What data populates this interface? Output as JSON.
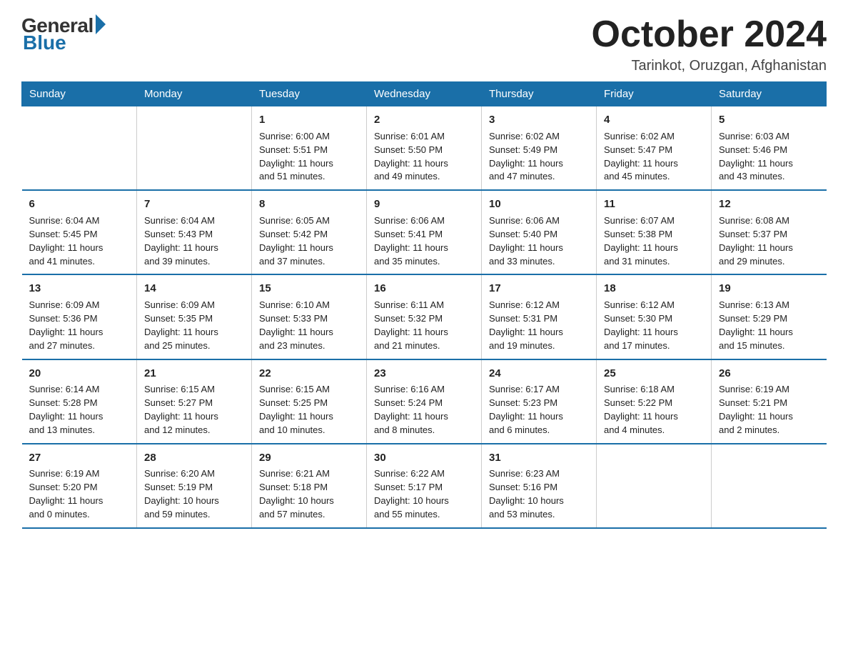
{
  "logo": {
    "general": "General",
    "blue": "Blue"
  },
  "title": "October 2024",
  "location": "Tarinkot, Oruzgan, Afghanistan",
  "headers": [
    "Sunday",
    "Monday",
    "Tuesday",
    "Wednesday",
    "Thursday",
    "Friday",
    "Saturday"
  ],
  "weeks": [
    [
      {
        "day": "",
        "info": ""
      },
      {
        "day": "",
        "info": ""
      },
      {
        "day": "1",
        "info": "Sunrise: 6:00 AM\nSunset: 5:51 PM\nDaylight: 11 hours\nand 51 minutes."
      },
      {
        "day": "2",
        "info": "Sunrise: 6:01 AM\nSunset: 5:50 PM\nDaylight: 11 hours\nand 49 minutes."
      },
      {
        "day": "3",
        "info": "Sunrise: 6:02 AM\nSunset: 5:49 PM\nDaylight: 11 hours\nand 47 minutes."
      },
      {
        "day": "4",
        "info": "Sunrise: 6:02 AM\nSunset: 5:47 PM\nDaylight: 11 hours\nand 45 minutes."
      },
      {
        "day": "5",
        "info": "Sunrise: 6:03 AM\nSunset: 5:46 PM\nDaylight: 11 hours\nand 43 minutes."
      }
    ],
    [
      {
        "day": "6",
        "info": "Sunrise: 6:04 AM\nSunset: 5:45 PM\nDaylight: 11 hours\nand 41 minutes."
      },
      {
        "day": "7",
        "info": "Sunrise: 6:04 AM\nSunset: 5:43 PM\nDaylight: 11 hours\nand 39 minutes."
      },
      {
        "day": "8",
        "info": "Sunrise: 6:05 AM\nSunset: 5:42 PM\nDaylight: 11 hours\nand 37 minutes."
      },
      {
        "day": "9",
        "info": "Sunrise: 6:06 AM\nSunset: 5:41 PM\nDaylight: 11 hours\nand 35 minutes."
      },
      {
        "day": "10",
        "info": "Sunrise: 6:06 AM\nSunset: 5:40 PM\nDaylight: 11 hours\nand 33 minutes."
      },
      {
        "day": "11",
        "info": "Sunrise: 6:07 AM\nSunset: 5:38 PM\nDaylight: 11 hours\nand 31 minutes."
      },
      {
        "day": "12",
        "info": "Sunrise: 6:08 AM\nSunset: 5:37 PM\nDaylight: 11 hours\nand 29 minutes."
      }
    ],
    [
      {
        "day": "13",
        "info": "Sunrise: 6:09 AM\nSunset: 5:36 PM\nDaylight: 11 hours\nand 27 minutes."
      },
      {
        "day": "14",
        "info": "Sunrise: 6:09 AM\nSunset: 5:35 PM\nDaylight: 11 hours\nand 25 minutes."
      },
      {
        "day": "15",
        "info": "Sunrise: 6:10 AM\nSunset: 5:33 PM\nDaylight: 11 hours\nand 23 minutes."
      },
      {
        "day": "16",
        "info": "Sunrise: 6:11 AM\nSunset: 5:32 PM\nDaylight: 11 hours\nand 21 minutes."
      },
      {
        "day": "17",
        "info": "Sunrise: 6:12 AM\nSunset: 5:31 PM\nDaylight: 11 hours\nand 19 minutes."
      },
      {
        "day": "18",
        "info": "Sunrise: 6:12 AM\nSunset: 5:30 PM\nDaylight: 11 hours\nand 17 minutes."
      },
      {
        "day": "19",
        "info": "Sunrise: 6:13 AM\nSunset: 5:29 PM\nDaylight: 11 hours\nand 15 minutes."
      }
    ],
    [
      {
        "day": "20",
        "info": "Sunrise: 6:14 AM\nSunset: 5:28 PM\nDaylight: 11 hours\nand 13 minutes."
      },
      {
        "day": "21",
        "info": "Sunrise: 6:15 AM\nSunset: 5:27 PM\nDaylight: 11 hours\nand 12 minutes."
      },
      {
        "day": "22",
        "info": "Sunrise: 6:15 AM\nSunset: 5:25 PM\nDaylight: 11 hours\nand 10 minutes."
      },
      {
        "day": "23",
        "info": "Sunrise: 6:16 AM\nSunset: 5:24 PM\nDaylight: 11 hours\nand 8 minutes."
      },
      {
        "day": "24",
        "info": "Sunrise: 6:17 AM\nSunset: 5:23 PM\nDaylight: 11 hours\nand 6 minutes."
      },
      {
        "day": "25",
        "info": "Sunrise: 6:18 AM\nSunset: 5:22 PM\nDaylight: 11 hours\nand 4 minutes."
      },
      {
        "day": "26",
        "info": "Sunrise: 6:19 AM\nSunset: 5:21 PM\nDaylight: 11 hours\nand 2 minutes."
      }
    ],
    [
      {
        "day": "27",
        "info": "Sunrise: 6:19 AM\nSunset: 5:20 PM\nDaylight: 11 hours\nand 0 minutes."
      },
      {
        "day": "28",
        "info": "Sunrise: 6:20 AM\nSunset: 5:19 PM\nDaylight: 10 hours\nand 59 minutes."
      },
      {
        "day": "29",
        "info": "Sunrise: 6:21 AM\nSunset: 5:18 PM\nDaylight: 10 hours\nand 57 minutes."
      },
      {
        "day": "30",
        "info": "Sunrise: 6:22 AM\nSunset: 5:17 PM\nDaylight: 10 hours\nand 55 minutes."
      },
      {
        "day": "31",
        "info": "Sunrise: 6:23 AM\nSunset: 5:16 PM\nDaylight: 10 hours\nand 53 minutes."
      },
      {
        "day": "",
        "info": ""
      },
      {
        "day": "",
        "info": ""
      }
    ]
  ]
}
